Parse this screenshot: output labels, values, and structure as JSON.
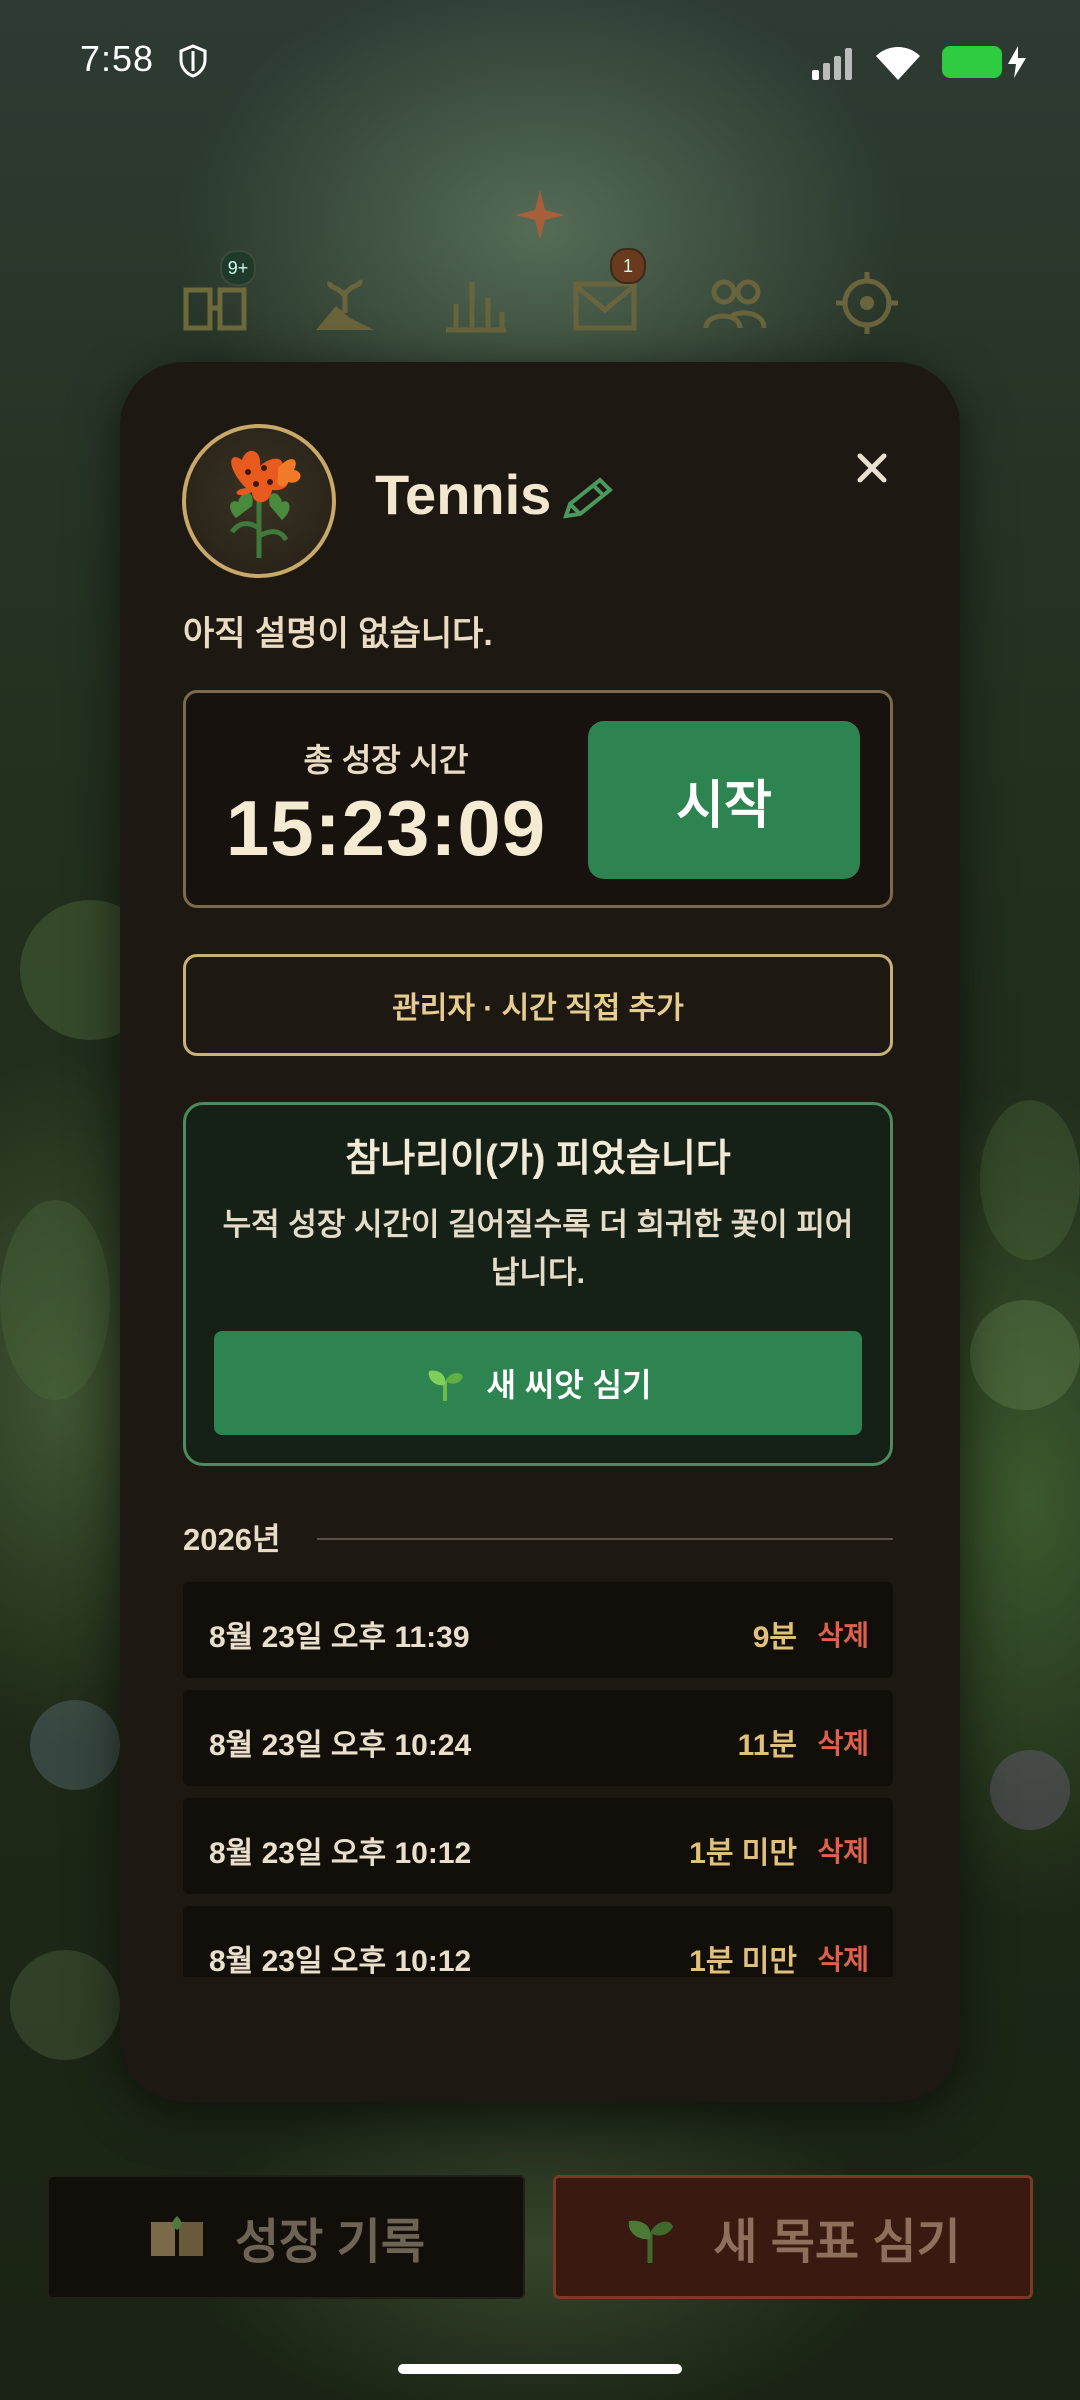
{
  "status_bar": {
    "time": "7:58"
  },
  "top_nav": {
    "badges": {
      "journal": "9+",
      "mail": "1"
    }
  },
  "modal": {
    "title": "Tennis",
    "description": "아직 설명이 없습니다.",
    "total_time_label": "총 성장 시간",
    "total_time_value": "15:23:09",
    "start_label": "시작",
    "admin_label": "관리자 · 시간 직접 추가",
    "bloom_title": "참나리이(가) 피었습니다",
    "bloom_text": "누적 성장 시간이 길어질수록 더 희귀한 꽃이 피어납니다.",
    "seed_button_label": "새 씨앗 심기",
    "year_label": "2026년",
    "records": [
      {
        "datetime": "8월 23일 오후 11:39",
        "duration": "9분",
        "delete": "삭제"
      },
      {
        "datetime": "8월 23일 오후 10:24",
        "duration": "11분",
        "delete": "삭제"
      },
      {
        "datetime": "8월 23일 오후 10:12",
        "duration": "1분 미만",
        "delete": "삭제"
      },
      {
        "datetime": "8월 23일 오후 10:12",
        "duration": "1분 미만",
        "delete": "삭제"
      }
    ]
  },
  "bottom": {
    "growth_log_label": "성장 기록",
    "new_goal_label": "새 목표 심기"
  },
  "colors": {
    "accent_green": "#2d8450",
    "modal_bg": "#1d1812",
    "delete_red": "#e0604e",
    "gold": "#e0c07a"
  }
}
